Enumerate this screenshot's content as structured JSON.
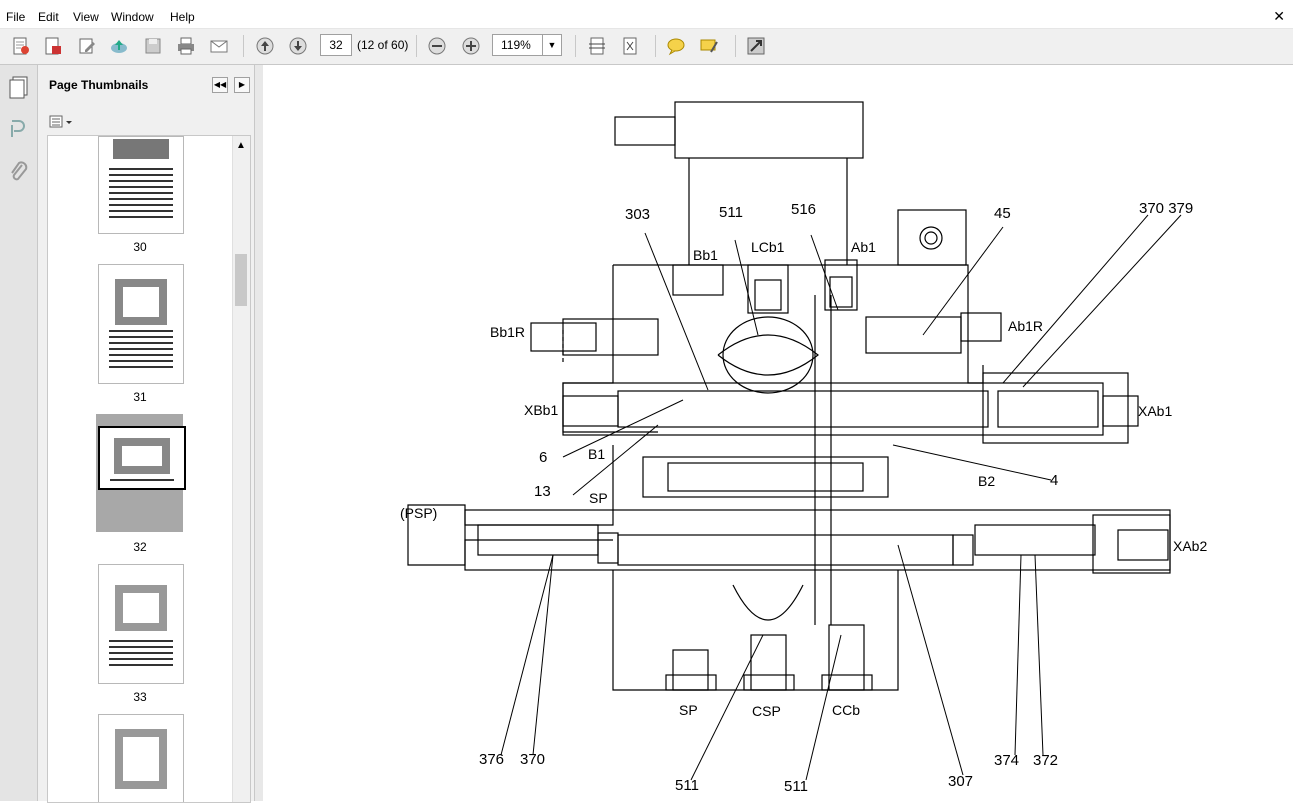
{
  "menu": [
    "File",
    "Edit",
    "View",
    "Window",
    "Help"
  ],
  "toolbar": {
    "page_number": "32",
    "page_count": "(12 of 60)",
    "zoom": "119%",
    "icons": [
      "create-pdf-icon",
      "open-icon",
      "edit-icon",
      "upload-icon",
      "save-icon",
      "print-icon",
      "email-icon",
      "prev-page-icon",
      "next-page-icon",
      "zoom-out-icon",
      "zoom-in-icon",
      "fit-page-icon",
      "fit-width-icon",
      "comment-icon",
      "highlight-icon",
      "fullscreen-icon"
    ]
  },
  "panel": {
    "title": "Page Thumbnails",
    "thumbnails": [
      {
        "label": "30"
      },
      {
        "label": "31"
      },
      {
        "label": "32",
        "selected": true
      },
      {
        "label": "33"
      },
      {
        "label": ""
      }
    ]
  },
  "diagram": {
    "labels": {
      "n303": "303",
      "n511a": "511",
      "n516": "516",
      "n45": "45",
      "n370_379": "370 379",
      "Bb1": "Bb1",
      "LCb1": "LCb1",
      "Ab1": "Ab1",
      "Bb1R": "Bb1R",
      "Ab1R": "Ab1R",
      "XBb1": "XBb1",
      "XAb1": "XAb1",
      "n6": "6",
      "B1": "B1",
      "n4": "4",
      "B2": "B2",
      "n13": "13",
      "SP_top": "SP",
      "PSP": "(PSP)",
      "XAb2": "XAb2",
      "SP": "SP",
      "CSP": "CSP",
      "CCb": "CCb",
      "n376": "376",
      "n370": "370",
      "n511b": "511",
      "n511c": "511",
      "n307": "307",
      "n374": "374",
      "n372": "372"
    }
  },
  "colors": {
    "toolbar_bg": "#f0f0f0",
    "panel_bg": "#f0f0f0",
    "selected_thumb": "#a8a8a8"
  }
}
